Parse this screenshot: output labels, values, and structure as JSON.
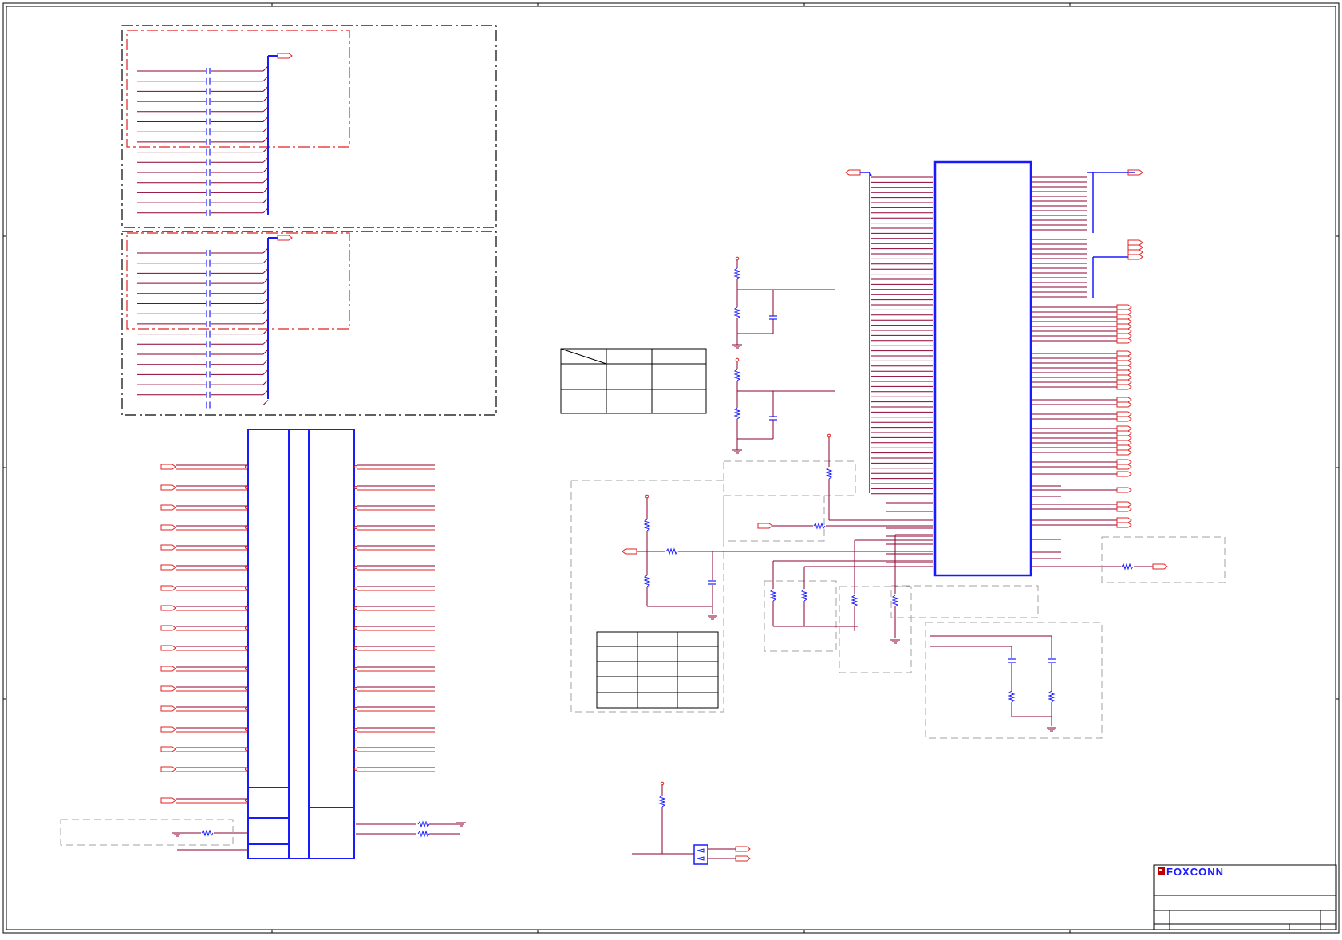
{
  "title_block": {
    "logo_text": "FOXCONN"
  },
  "colors": {
    "wire": "#8b0030",
    "pin": "#e02020",
    "part": "#1a1aff",
    "frame": "#000000",
    "note": "#a0a0a0",
    "group_red": "#e02020"
  }
}
